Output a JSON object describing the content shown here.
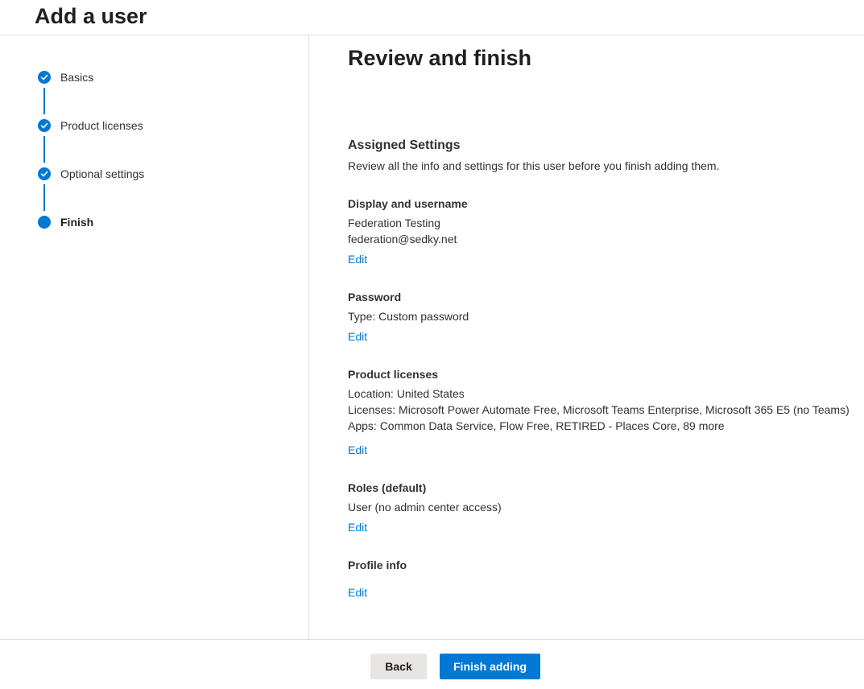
{
  "page_title": "Add a user",
  "stepper": {
    "steps": [
      {
        "label": "Basics",
        "state": "completed"
      },
      {
        "label": "Product licenses",
        "state": "completed"
      },
      {
        "label": "Optional settings",
        "state": "completed"
      },
      {
        "label": "Finish",
        "state": "current"
      }
    ]
  },
  "main": {
    "title": "Review and finish",
    "assigned_heading": "Assigned Settings",
    "assigned_desc": "Review all the info and settings for this user before you finish adding them.",
    "display": {
      "heading": "Display and username",
      "name": "Federation Testing",
      "username": "federation@sedky.net",
      "edit": "Edit"
    },
    "password": {
      "heading": "Password",
      "type": "Type: Custom password",
      "edit": "Edit"
    },
    "licenses": {
      "heading": "Product licenses",
      "location": "Location: United States",
      "licenses": "Licenses: Microsoft Power Automate Free, Microsoft Teams Enterprise, Microsoft 365 E5 (no Teams)",
      "apps": "Apps: Common Data Service, Flow Free, RETIRED - Places Core, 89 more",
      "edit": "Edit"
    },
    "roles": {
      "heading": "Roles (default)",
      "value": "User (no admin center access)",
      "edit": "Edit"
    },
    "profile": {
      "heading": "Profile info",
      "edit": "Edit"
    }
  },
  "footer": {
    "back_label": "Back",
    "finish_label": "Finish adding"
  },
  "colors": {
    "accent": "#0078d4",
    "divider": "#e1dfdd",
    "text": "#323130"
  }
}
